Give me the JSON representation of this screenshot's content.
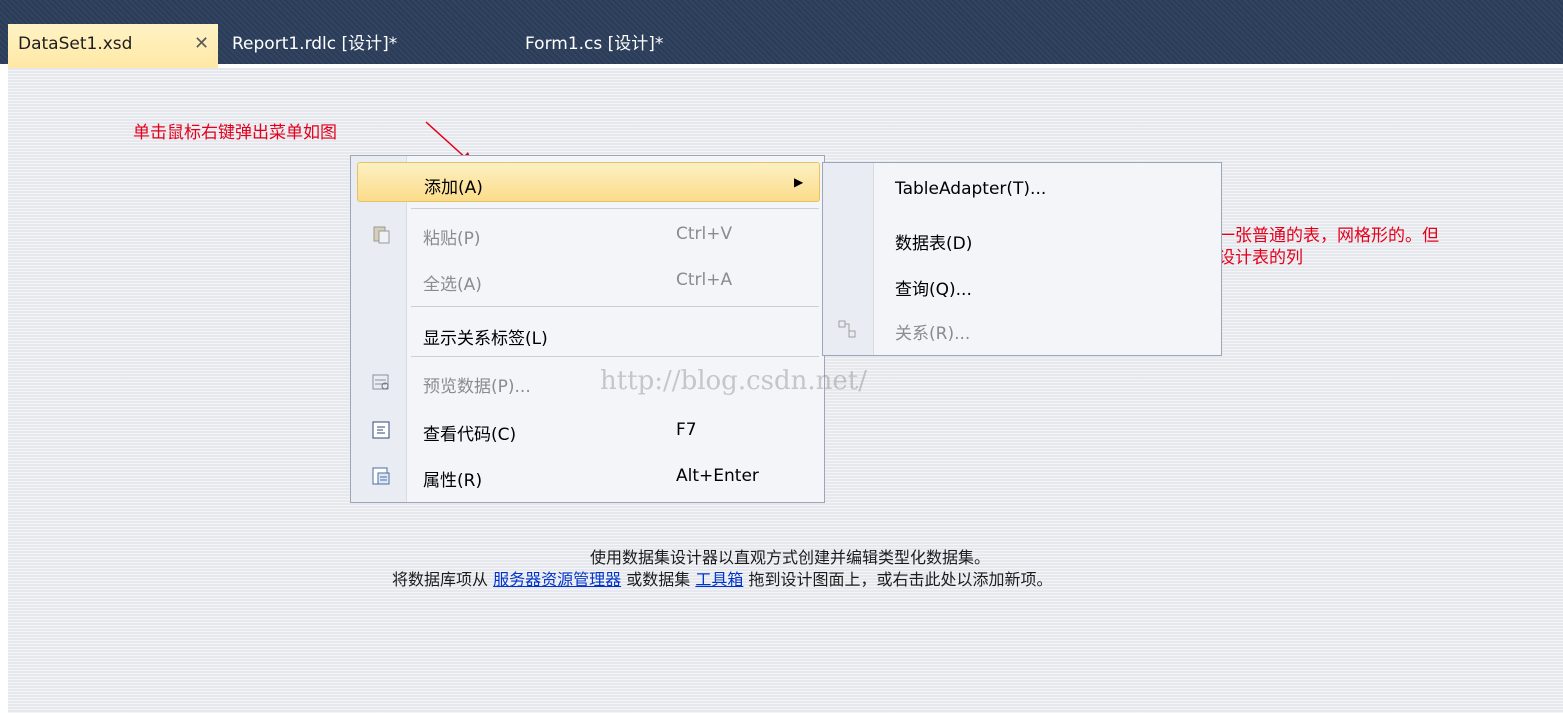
{
  "tabs": [
    {
      "label": "DataSet1.xsd",
      "active": true,
      "close_icon": "close-icon"
    },
    {
      "label": "Report1.rdlc [设计]*",
      "active": false
    },
    {
      "label": "Form1.cs [设计]*",
      "active": false
    }
  ],
  "annotations": {
    "top": "单击鼠标右键弹出菜单如图",
    "right_line1": "这个就是一张普通的表，网格形的。但",
    "right_line2": "是这里是设计表的列"
  },
  "context_menu": {
    "items": [
      {
        "label": "添加(A)",
        "shortcut": "",
        "submenu": true,
        "highlighted": true,
        "enabled": true,
        "icon": ""
      },
      {
        "label": "粘贴(P)",
        "shortcut": "Ctrl+V",
        "enabled": false,
        "icon": "paste-icon"
      },
      {
        "label": "全选(A)",
        "shortcut": "Ctrl+A",
        "enabled": false,
        "icon": ""
      },
      {
        "label": "显示关系标签(L)",
        "shortcut": "",
        "enabled": true,
        "icon": ""
      },
      {
        "label": "预览数据(P)...",
        "shortcut": "",
        "enabled": false,
        "icon": "preview-data-icon"
      },
      {
        "label": "查看代码(C)",
        "shortcut": "F7",
        "enabled": true,
        "icon": "view-code-icon"
      },
      {
        "label": "属性(R)",
        "shortcut": "Alt+Enter",
        "enabled": true,
        "icon": "properties-icon"
      }
    ]
  },
  "submenu": {
    "items": [
      {
        "label": "TableAdapter(T)...",
        "enabled": true,
        "icon": ""
      },
      {
        "label": "数据表(D)",
        "enabled": true,
        "icon": ""
      },
      {
        "label": "查询(Q)...",
        "enabled": true,
        "icon": ""
      },
      {
        "label": "关系(R)...",
        "enabled": false,
        "icon": "relation-icon"
      }
    ]
  },
  "watermark": "http://blog.csdn.net/",
  "designer_hint": {
    "line1": "使用数据集设计器以直观方式创建并编辑类型化数据集。",
    "line2_prefix": "将数据库项从",
    "link1": "服务器资源管理器",
    "line2_middle": "或数据集",
    "link2": "工具箱",
    "line2_suffix": "拖到设计图面上，或右击此处以添加新项。"
  },
  "colors": {
    "tabbar_bg": "#2b3c59",
    "active_tab_bg": "#ffe8a6",
    "annotation_red": "#e3001b",
    "menu_highlight": "#fbdc8a",
    "link_blue": "#0033cc"
  }
}
